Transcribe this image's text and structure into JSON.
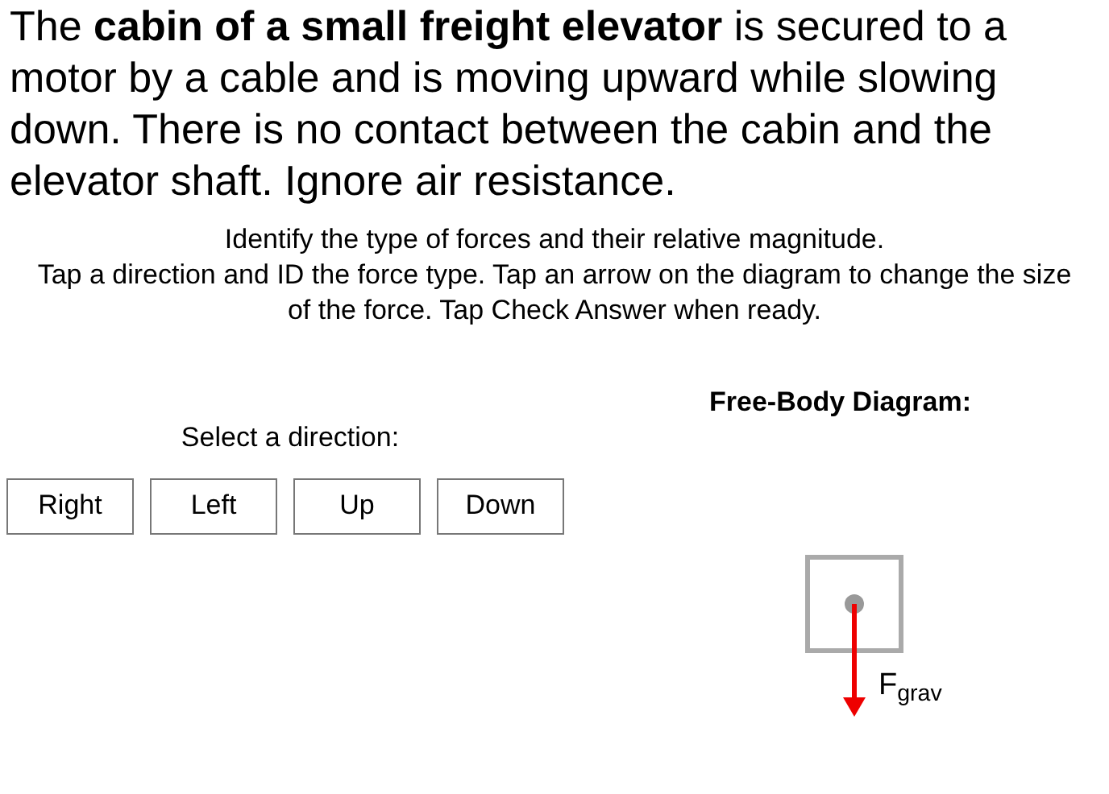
{
  "problem": {
    "text": "The **cabin of a small freight elevator** is secured to a motor by a cable and is moving upward while slowing down. There is no contact between the cabin and the elevator shaft. Ignore air resistance."
  },
  "instructions": [
    "Identify the type of forces and their relative magnitude.",
    "Tap a direction and ID the force type. Tap an arrow on the diagram to change the size of the force. Tap Check Answer when ready."
  ],
  "direction_picker": {
    "label": "Select a direction:",
    "buttons": [
      {
        "label": "Right"
      },
      {
        "label": "Left"
      },
      {
        "label": "Up"
      },
      {
        "label": "Down"
      }
    ]
  },
  "free_body_diagram": {
    "title": "Free-Body Diagram:",
    "forces": [
      {
        "kind": "down",
        "label": "F$_{grav}$"
      }
    ]
  }
}
